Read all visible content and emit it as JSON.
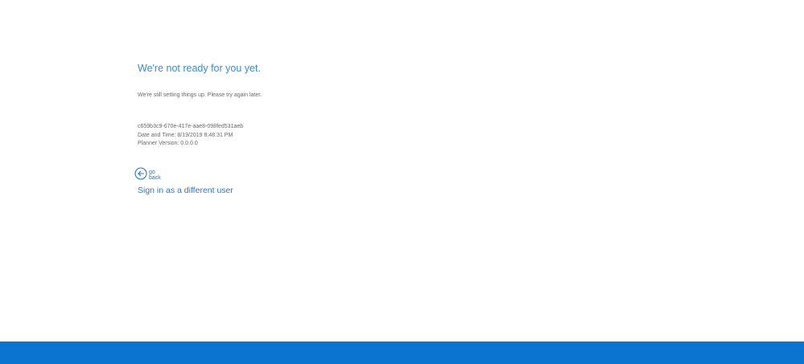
{
  "error": {
    "title": "We're not ready for you yet.",
    "message": "We're still setting things up. Please try again later."
  },
  "diagnostics": {
    "session_id": "c659b3c9-670e-417e-aae8-098fed531aeb",
    "date_time": "Date and Time: 8/19/2019 8:48:31 PM",
    "planner_version": "Planner Version: 0.0.0.0"
  },
  "actions": {
    "go_back_icon": "back-arrow-circle-icon",
    "go_back_label": "go back",
    "sign_in_label": "Sign in as a different user"
  },
  "colors": {
    "title": "#3d8ad1",
    "link": "#2c76c9",
    "footer_bar": "#0b74d1",
    "body_text": "#6a6a6a"
  }
}
